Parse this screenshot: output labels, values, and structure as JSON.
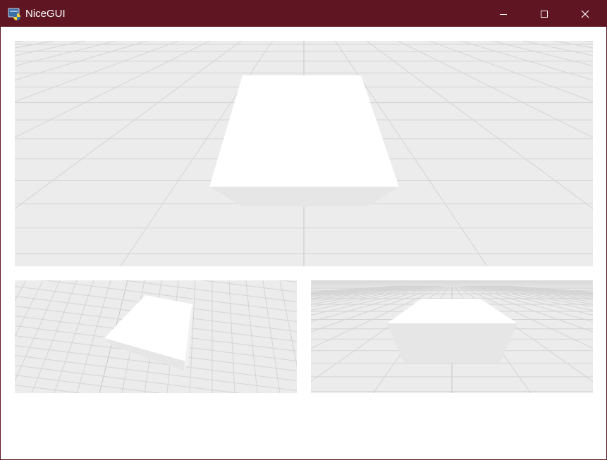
{
  "window": {
    "title": "NiceGUI",
    "colors": {
      "titlebar": "#5f1622",
      "scene_bg": "#ececec",
      "grid": "#d6d6d6",
      "grid_major": "#c8c8c8",
      "cube_top": "#ffffff",
      "cube_side": "#e6e6e6"
    },
    "icons": {
      "app": "python-app-icon",
      "minimize": "minimize-icon",
      "maximize": "maximize-icon",
      "close": "close-icon"
    }
  },
  "scenes": [
    "main-scene",
    "left-scene",
    "right-scene"
  ]
}
